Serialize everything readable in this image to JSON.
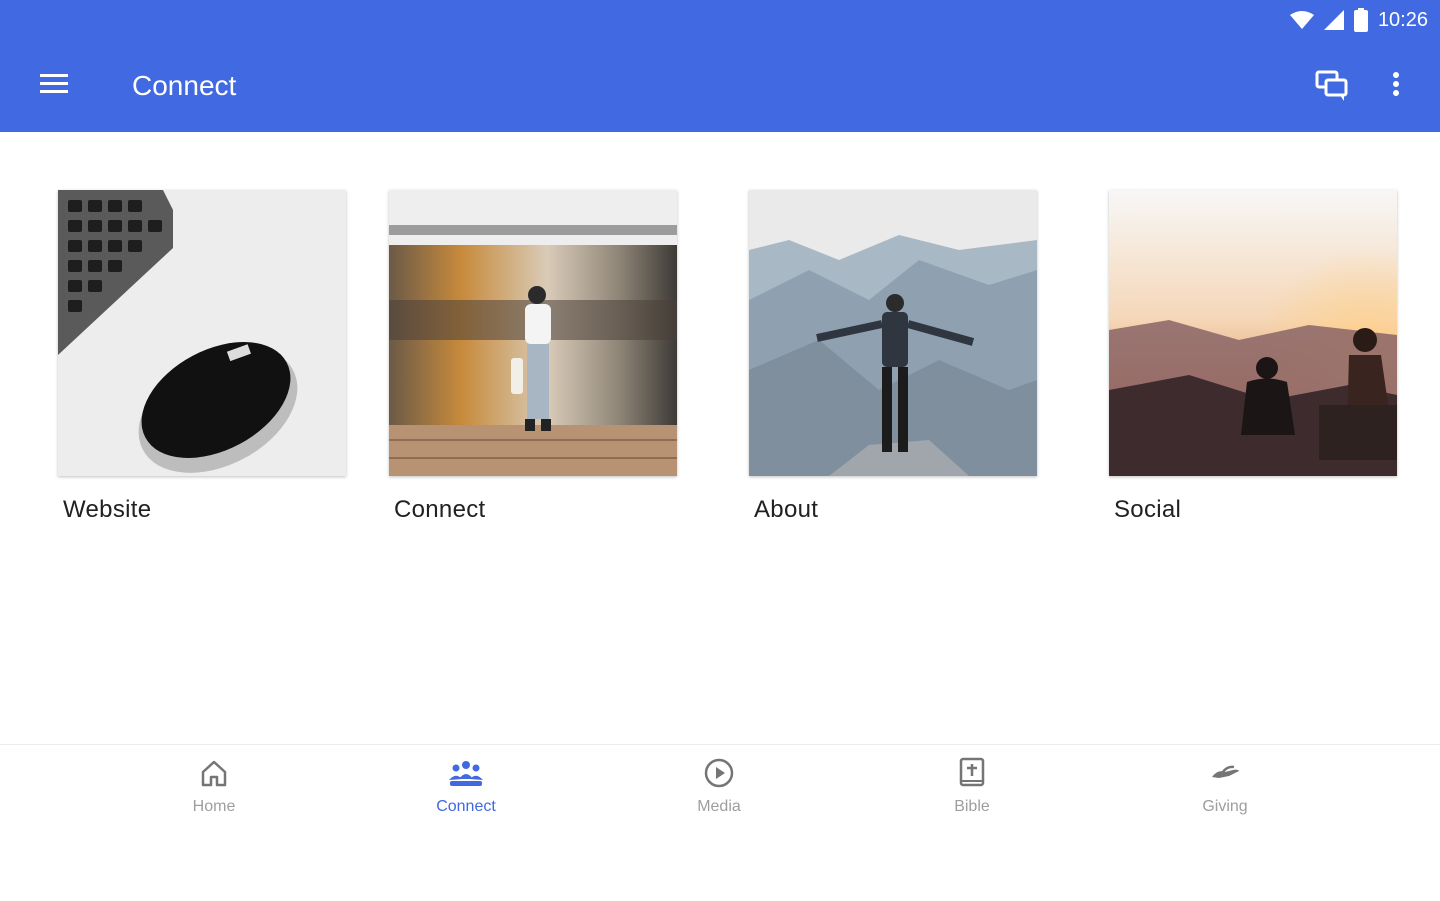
{
  "status_bar": {
    "time": "10:26"
  },
  "app_bar": {
    "title": "Connect",
    "menu_icon": "hamburger-menu-icon",
    "chat_icon": "chat-bubbles-icon",
    "more_icon": "more-vert-icon"
  },
  "tiles": [
    {
      "label": "Website",
      "image": "keyboard-and-mouse-photo"
    },
    {
      "label": "Connect",
      "image": "train-platform-woman-photo"
    },
    {
      "label": "About",
      "image": "man-on-mountain-photo"
    },
    {
      "label": "Social",
      "image": "sunset-hikers-photo"
    }
  ],
  "bottom_nav": {
    "items": [
      {
        "label": "Home",
        "icon": "home-icon",
        "active": false
      },
      {
        "label": "Connect",
        "icon": "people-group-icon",
        "active": true
      },
      {
        "label": "Media",
        "icon": "play-circle-icon",
        "active": false
      },
      {
        "label": "Bible",
        "icon": "bible-icon",
        "active": false
      },
      {
        "label": "Giving",
        "icon": "giving-hand-icon",
        "active": false
      }
    ]
  },
  "colors": {
    "primary": "#4169E1",
    "text": "#212121",
    "inactive": "#9e9e9e",
    "background": "#ffffff"
  }
}
